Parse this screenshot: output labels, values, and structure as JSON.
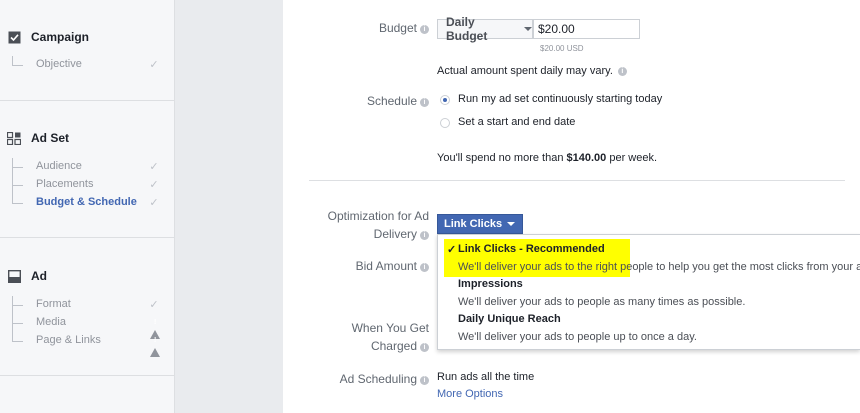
{
  "sidebar": {
    "campaign": {
      "title": "Campaign",
      "items": [
        {
          "label": "Objective",
          "status": "check"
        }
      ]
    },
    "adset": {
      "title": "Ad Set",
      "items": [
        {
          "label": "Audience",
          "status": "check"
        },
        {
          "label": "Placements",
          "status": "check"
        },
        {
          "label": "Budget & Schedule",
          "status": "check",
          "active": true
        }
      ]
    },
    "ad": {
      "title": "Ad",
      "items": [
        {
          "label": "Format",
          "status": "check"
        },
        {
          "label": "Media",
          "status": "warning"
        },
        {
          "label": "Page & Links",
          "status": "warning"
        }
      ]
    }
  },
  "budget": {
    "label": "Budget",
    "type_selected": "Daily Budget",
    "amount_value": "$20.00",
    "amount_hint": "$20.00 USD",
    "note": "Actual amount spent daily may vary."
  },
  "schedule": {
    "label": "Schedule",
    "options": [
      {
        "label": "Run my ad set continuously starting today",
        "selected": true
      },
      {
        "label": "Set a start and end date",
        "selected": false
      }
    ],
    "summary_prefix": "You'll spend no more than ",
    "summary_amount": "$140.00",
    "summary_suffix": " per week."
  },
  "optimization": {
    "label_line1": "Optimization for Ad",
    "label_line2": "Delivery",
    "selected": "Link Clicks",
    "options": [
      {
        "title": "Link Clicks - Recommended",
        "desc": "We'll deliver your ads to the right people to help you get the most clicks from your ad t",
        "checked": true,
        "highlight": "#ffff00"
      },
      {
        "title": "Impressions",
        "desc": "We'll deliver your ads to people as many times as possible.",
        "checked": false
      },
      {
        "title": "Daily Unique Reach",
        "desc": "We'll deliver your ads to people up to once a day.",
        "checked": false
      }
    ]
  },
  "bid_amount": {
    "label": "Bid Amount"
  },
  "charged": {
    "label_line1": "When You Get",
    "label_line2": "Charged"
  },
  "ad_scheduling": {
    "label": "Ad Scheduling",
    "value": "Run ads all the time",
    "more_link": "More Options"
  },
  "colors": {
    "accent": "#4267b2",
    "highlight": "#ffff00",
    "sidebar_bg": "#f6f7f9",
    "page_bg": "#e9ebee"
  },
  "icons": {
    "info": "info-icon",
    "check": "checkmark-icon",
    "warning": "warning-icon",
    "campaign": "checkbox-icon",
    "adset": "grid-icon",
    "ad": "ad-square-icon"
  }
}
